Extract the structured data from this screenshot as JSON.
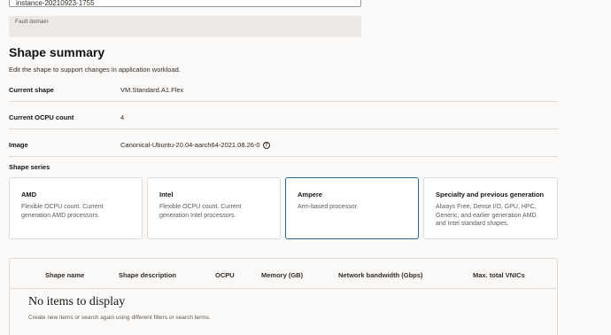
{
  "instance": {
    "name_value": "instance-20210923-1755",
    "fault_domain_label": "Fault domain"
  },
  "shape_summary": {
    "title": "Shape summary",
    "description": "Edit the shape to support changes in application workload.",
    "rows": [
      {
        "label": "Current shape",
        "value": "VM.Standard.A1.Flex"
      },
      {
        "label": "Current OCPU count",
        "value": "4"
      },
      {
        "label": "Image",
        "value": "Canonical-Ubuntu-20.04-aarch64-2021.08.26-0"
      }
    ],
    "help_icon": "?"
  },
  "shape_series": {
    "label": "Shape series",
    "cards": [
      {
        "title": "AMD",
        "description": "Flexible OCPU count. Current generation AMD processors.",
        "selected": false
      },
      {
        "title": "Intel",
        "description": "Flexible OCPU count. Current generation Intel processors.",
        "selected": false
      },
      {
        "title": "Ampere",
        "description": "Arm-based processor.",
        "selected": true
      },
      {
        "title": "Specialty and previous generation",
        "description": "Always Free, Dense I/O, GPU, HPC, Generic, and earlier generation AMD and Intel standard shapes.",
        "selected": false
      }
    ]
  },
  "shapes_table": {
    "columns": [
      "Shape name",
      "Shape description",
      "OCPU",
      "Memory (GB)",
      "Network bandwidth (Gbps)",
      "Max. total VNICs"
    ],
    "empty_title": "No items to display",
    "empty_description": "Create new items or search again using different filters or search terms."
  },
  "colors": {
    "selected_border": "#2b6a7f",
    "background": "#fbf9f8"
  }
}
